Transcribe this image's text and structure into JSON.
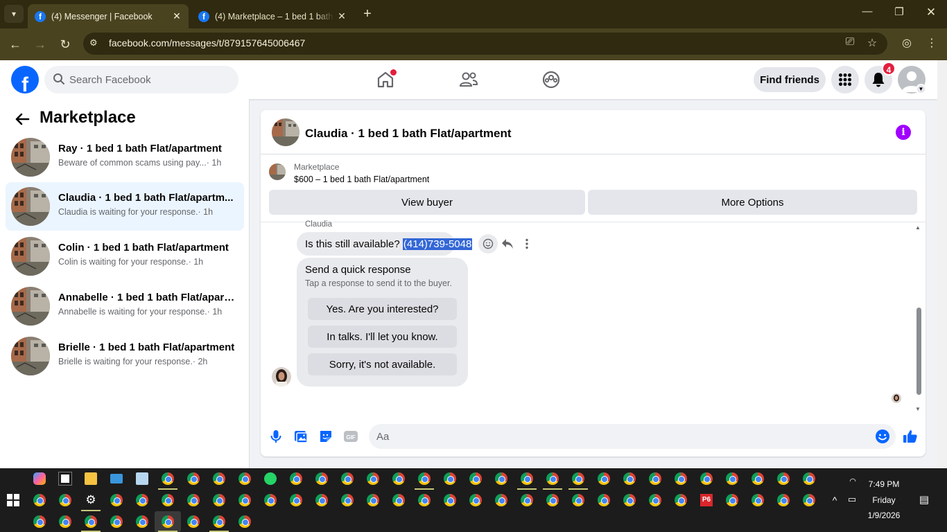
{
  "browser": {
    "tabs": [
      {
        "title": "(4) Messenger | Facebook",
        "active": true
      },
      {
        "title": "(4) Marketplace – 1 bed 1 bath F",
        "active": false
      }
    ],
    "url": "facebook.com/messages/t/879157645006467"
  },
  "fb": {
    "search_placeholder": "Search Facebook",
    "find_friends": "Find friends",
    "notif_count": "4",
    "brand_color": "#0866ff"
  },
  "sidebar": {
    "title": "Marketplace",
    "conversations": [
      {
        "title": "Ray · 1 bed 1 bath Flat/apartment",
        "snippet": "Beware of common scams using pay...",
        "time": "· 1h",
        "selected": false
      },
      {
        "title": "Claudia · 1 bed 1 bath Flat/apartm...",
        "snippet": "Claudia is waiting for your response.",
        "time": "· 1h",
        "selected": true
      },
      {
        "title": "Colin · 1 bed 1 bath Flat/apartment",
        "snippet": "Colin is waiting for your response.",
        "time": "· 1h",
        "selected": false
      },
      {
        "title": "Annabelle · 1 bed 1 bath Flat/apart...",
        "snippet": "Annabelle is waiting for your response.",
        "time": "· 1h",
        "selected": false
      },
      {
        "title": "Brielle · 1 bed 1 bath Flat/apartment",
        "snippet": "Brielle is waiting for your response.",
        "time": "· 2h",
        "selected": false
      }
    ]
  },
  "chat": {
    "title": "Claudia · 1 bed 1 bath Flat/apartment",
    "listing_label": "Marketplace",
    "listing_name": "$600 – 1 bed 1 bath Flat/apartment",
    "view_buyer": "View buyer",
    "more_options": "More Options",
    "sender": "Claudia",
    "message_text": "Is this still available? ",
    "message_highlight": "(414)739-5048",
    "quick_title": "Send a quick response",
    "quick_sub": "Tap a response to send it to the buyer.",
    "quick_options": [
      "Yes. Are you interested?",
      "In talks. I'll let you know.",
      "Sorry, it's not available."
    ],
    "composer_placeholder": "Aa",
    "accent": "#0866ff"
  },
  "taskbar": {
    "time": "7:49 PM",
    "day": "Friday",
    "date": "1/9/2026",
    "p6_label": "P6"
  }
}
